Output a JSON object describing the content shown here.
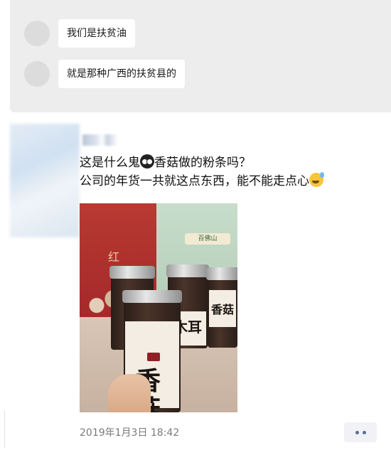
{
  "chat": {
    "messages": [
      {
        "text": "我们是扶贫油"
      },
      {
        "text": "就是那种广西的扶贫县的"
      }
    ]
  },
  "moment": {
    "nickname": "",
    "text_line1_a": "这是什么鬼",
    "text_line1_b": "香菇做的粉条吗？",
    "text_line2": "公司的年货一共就这点东西，能不能走点心",
    "photo": {
      "bag_text": "红",
      "green_bag_logo": "百佛山",
      "jar_main_label": "香菇",
      "jar2_label": "木耳",
      "jar3_label": "香菇"
    },
    "timestamp": "2019年1月3日 18:42"
  },
  "icons": {
    "emoji1": "owl-face-icon",
    "emoji2": "sweat-smile-icon",
    "more": "more-dots-icon"
  },
  "colors": {
    "chat_bg": "#ededed",
    "timestamp": "#7a7a7a",
    "more_dots": "#5a6e94"
  }
}
